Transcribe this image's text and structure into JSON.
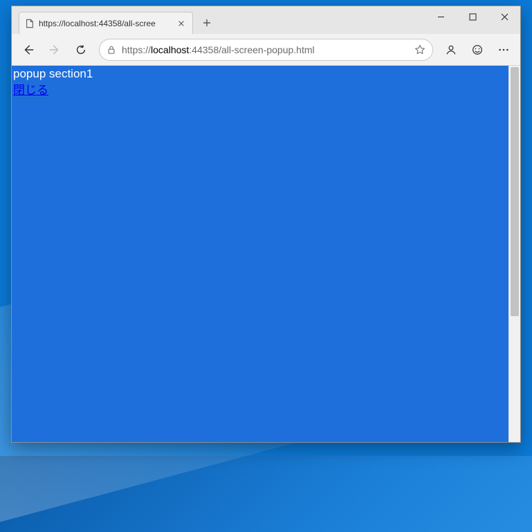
{
  "browser": {
    "tab": {
      "title": "https://localhost:44358/all-scree"
    },
    "address": {
      "prefix": "https://",
      "host": "localhost",
      "suffix": ":44358/all-screen-popup.html"
    }
  },
  "page": {
    "popup_title": "popup section1",
    "close_label": "閉じる"
  }
}
